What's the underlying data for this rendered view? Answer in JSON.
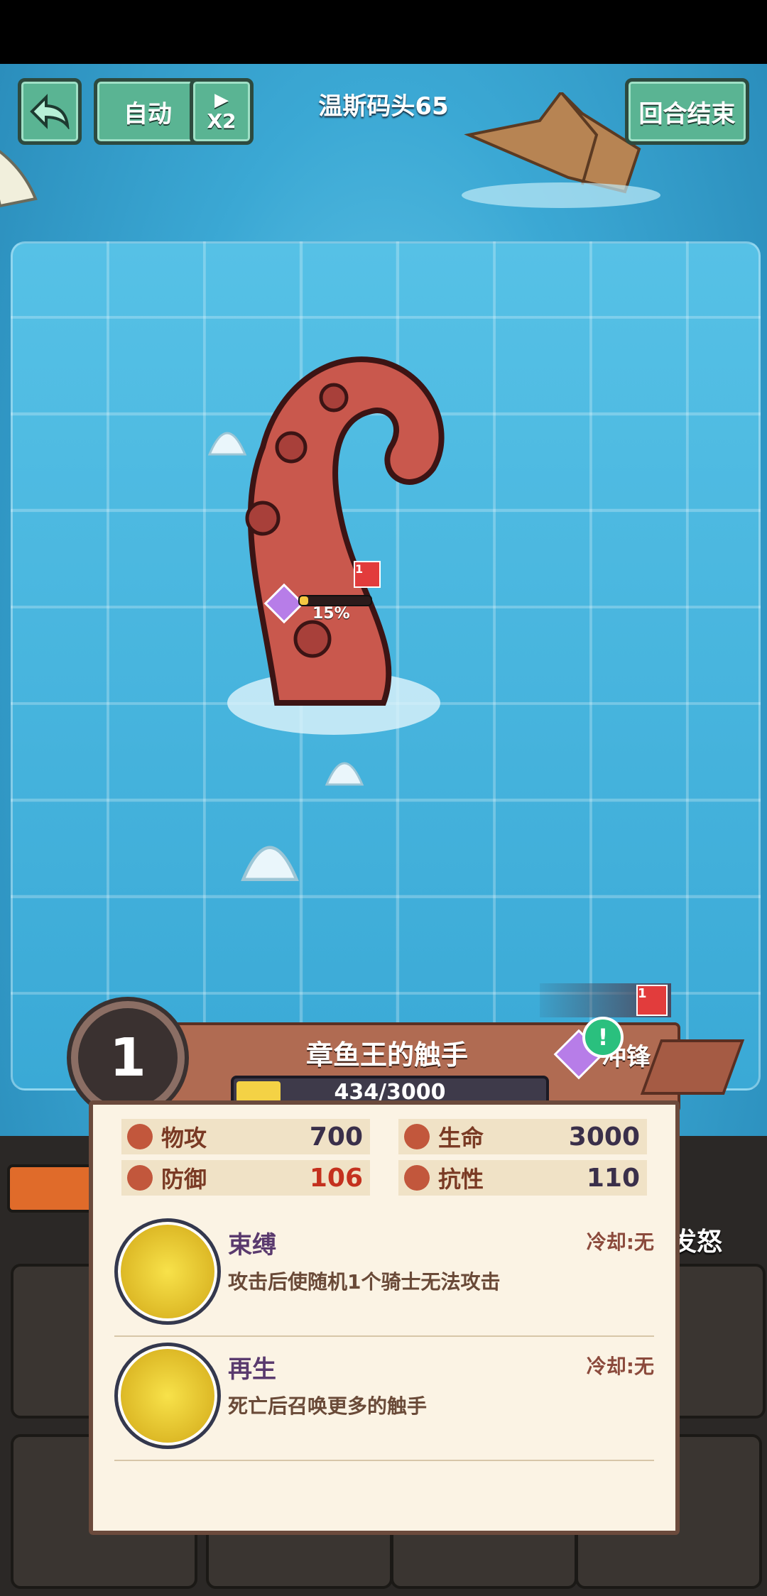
{
  "top_bar": {
    "back_label": "",
    "auto_label": "自动",
    "speed_label": "X2",
    "level_title": "温斯码头65",
    "end_turn_label": "回合结束"
  },
  "enemy": {
    "hp_percent_label": "15%",
    "buff_count": "1"
  },
  "card": {
    "level": "1",
    "name": "章鱼王的触手",
    "hp_text": "434/3000",
    "hp_current": 434,
    "hp_max": 3000,
    "tag_label": "冲锋",
    "top_badge_count": "1",
    "alert_symbol": "!",
    "stats": {
      "atk_label": "物攻",
      "atk_value": "700",
      "hp_label": "生命",
      "hp_value": "3000",
      "def_label": "防御",
      "def_value": "106",
      "res_label": "抗性",
      "res_value": "110"
    },
    "skills": [
      {
        "name": "束缚",
        "cooldown": "冷却:无",
        "desc": "攻击后使随机1个骑士无法攻击",
        "icon": "chain-icon"
      },
      {
        "name": "再生",
        "cooldown": "冷却:无",
        "desc": "死亡后召唤更多的触手",
        "icon": "tentacle-icon"
      }
    ]
  },
  "side": {
    "rage_label": "发怒"
  },
  "colors": {
    "button_green": "#5ab493",
    "card_bg": "#fbf3e4",
    "ribbon": "#b06b52",
    "hp_fill": "#f4d245",
    "def_red": "#c4311e"
  }
}
